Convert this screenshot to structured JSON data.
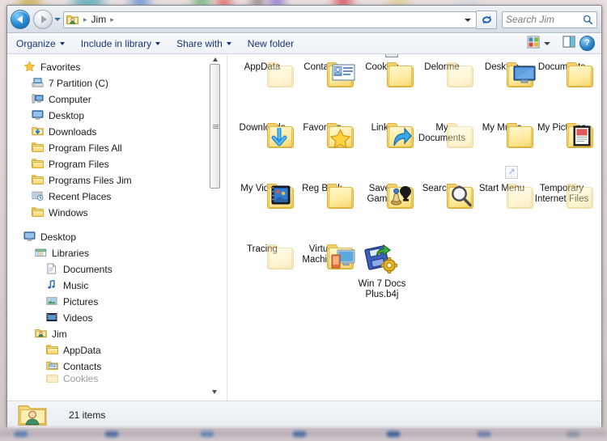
{
  "window": {
    "title": "Jim",
    "nav": {
      "back_label": "Back",
      "forward_label": "Forward",
      "history_label": "Recent pages",
      "refresh_label": "Refresh",
      "breadcrumb": [
        {
          "label": "Jim",
          "icon": "user-folder-icon"
        }
      ],
      "breadcrumb_separator": "▸"
    },
    "search": {
      "placeholder": "Search Jim",
      "icon": "search-icon"
    }
  },
  "toolbar": {
    "items": [
      {
        "label": "Organize",
        "has_caret": true
      },
      {
        "label": "Include in library",
        "has_caret": true
      },
      {
        "label": "Share with",
        "has_caret": true
      },
      {
        "label": "New folder",
        "has_caret": false
      }
    ],
    "view_button_label": "Change your view",
    "view_icon": "view-options-icon",
    "view_caret_label": "More options",
    "preview_pane_label": "Show the preview pane",
    "preview_icon": "preview-pane-icon",
    "help_label": "Get help",
    "help_glyph": "?"
  },
  "sidebar": {
    "groups": [
      {
        "header": {
          "label": "Favorites",
          "icon": "star-icon"
        },
        "items": [
          {
            "label": "7 Partition (C)",
            "icon": "drive-icon"
          },
          {
            "label": "Computer",
            "icon": "computer-icon"
          },
          {
            "label": "Desktop",
            "icon": "desktop-icon"
          },
          {
            "label": "Downloads",
            "icon": "downloads-folder-icon"
          },
          {
            "label": "Program Files All",
            "icon": "folder-icon"
          },
          {
            "label": "Program Files",
            "icon": "folder-icon"
          },
          {
            "label": "Programs Files Jim",
            "icon": "folder-icon"
          },
          {
            "label": "Recent Places",
            "icon": "recent-places-icon"
          },
          {
            "label": "Windows",
            "icon": "folder-icon"
          }
        ]
      },
      {
        "header": {
          "label": "Desktop",
          "icon": "desktop-icon"
        },
        "items": [
          {
            "label": "Libraries",
            "icon": "libraries-icon",
            "indent": 1
          },
          {
            "label": "Documents",
            "icon": "documents-library-icon",
            "indent": 2
          },
          {
            "label": "Music",
            "icon": "music-library-icon",
            "indent": 2
          },
          {
            "label": "Pictures",
            "icon": "pictures-library-icon",
            "indent": 2
          },
          {
            "label": "Videos",
            "icon": "videos-library-icon",
            "indent": 2
          },
          {
            "label": "Jim",
            "icon": "user-folder-icon",
            "indent": 1
          },
          {
            "label": "AppData",
            "icon": "folder-icon",
            "indent": 2
          },
          {
            "label": "Contacts",
            "icon": "contacts-folder-icon",
            "indent": 2
          },
          {
            "label": "Cookies",
            "icon": "folder-icon",
            "indent": 2,
            "clipped": true
          }
        ]
      }
    ],
    "scrollbar": {
      "up_label": "Scroll up",
      "down_label": "Scroll down",
      "thumb_label": "Scroll thumb"
    }
  },
  "content": {
    "items": [
      {
        "name": "AppData",
        "icon": "folder-icon",
        "faded": true,
        "overlay": "none"
      },
      {
        "name": "Contacts",
        "icon": "contacts-folder-icon",
        "faded": false,
        "overlay": "none"
      },
      {
        "name": "Cookies",
        "icon": "folder-icon",
        "faded": false,
        "overlay": "shortcut"
      },
      {
        "name": "Delorme",
        "icon": "folder-icon",
        "faded": true,
        "overlay": "none"
      },
      {
        "name": "Desktop",
        "icon": "desktop-folder-icon",
        "faded": false,
        "overlay": "none"
      },
      {
        "name": "Documents",
        "icon": "folder-icon",
        "faded": false,
        "overlay": "none"
      },
      {
        "name": "Downloads",
        "icon": "downloads-folder-icon",
        "faded": false,
        "overlay": "none"
      },
      {
        "name": "Favorites",
        "icon": "favorites-folder-icon",
        "faded": false,
        "overlay": "none"
      },
      {
        "name": "Links",
        "icon": "links-folder-icon",
        "faded": false,
        "overlay": "none"
      },
      {
        "name": "My Documents",
        "icon": "folder-icon",
        "faded": true,
        "overlay": "none"
      },
      {
        "name": "My Music",
        "icon": "folder-icon",
        "faded": false,
        "overlay": "none"
      },
      {
        "name": "My Pictures",
        "icon": "pictures-folder-icon",
        "faded": false,
        "overlay": "none"
      },
      {
        "name": "My Videos",
        "icon": "videos-folder-icon",
        "faded": false,
        "overlay": "none"
      },
      {
        "name": "Reg Back",
        "icon": "folder-icon",
        "faded": false,
        "overlay": "none"
      },
      {
        "name": "Saved Games",
        "icon": "saved-games-folder-icon",
        "faded": false,
        "overlay": "none"
      },
      {
        "name": "Searches",
        "icon": "searches-folder-icon",
        "faded": false,
        "overlay": "none"
      },
      {
        "name": "Start Menu",
        "icon": "folder-icon",
        "faded": true,
        "overlay": "shortcut"
      },
      {
        "name": "Temporary Internet Files",
        "icon": "folder-icon",
        "faded": true,
        "overlay": "none"
      },
      {
        "name": "Tracing",
        "icon": "folder-icon",
        "faded": true,
        "overlay": "none"
      },
      {
        "name": "Virtual Machines",
        "icon": "virtual-machines-icon",
        "faded": false,
        "overlay": "none"
      },
      {
        "name": "Win 7 Docs Plus.b4j",
        "icon": "backup-file-icon",
        "faded": false,
        "overlay": "none"
      }
    ]
  },
  "status": {
    "text": "21 items",
    "icon": "user-folder-icon"
  },
  "colors": {
    "accent_blue": "#15347a",
    "folder_yellow": "#f3c84f",
    "window_border": "#7d8a96",
    "glass": "#e2e7ee"
  }
}
